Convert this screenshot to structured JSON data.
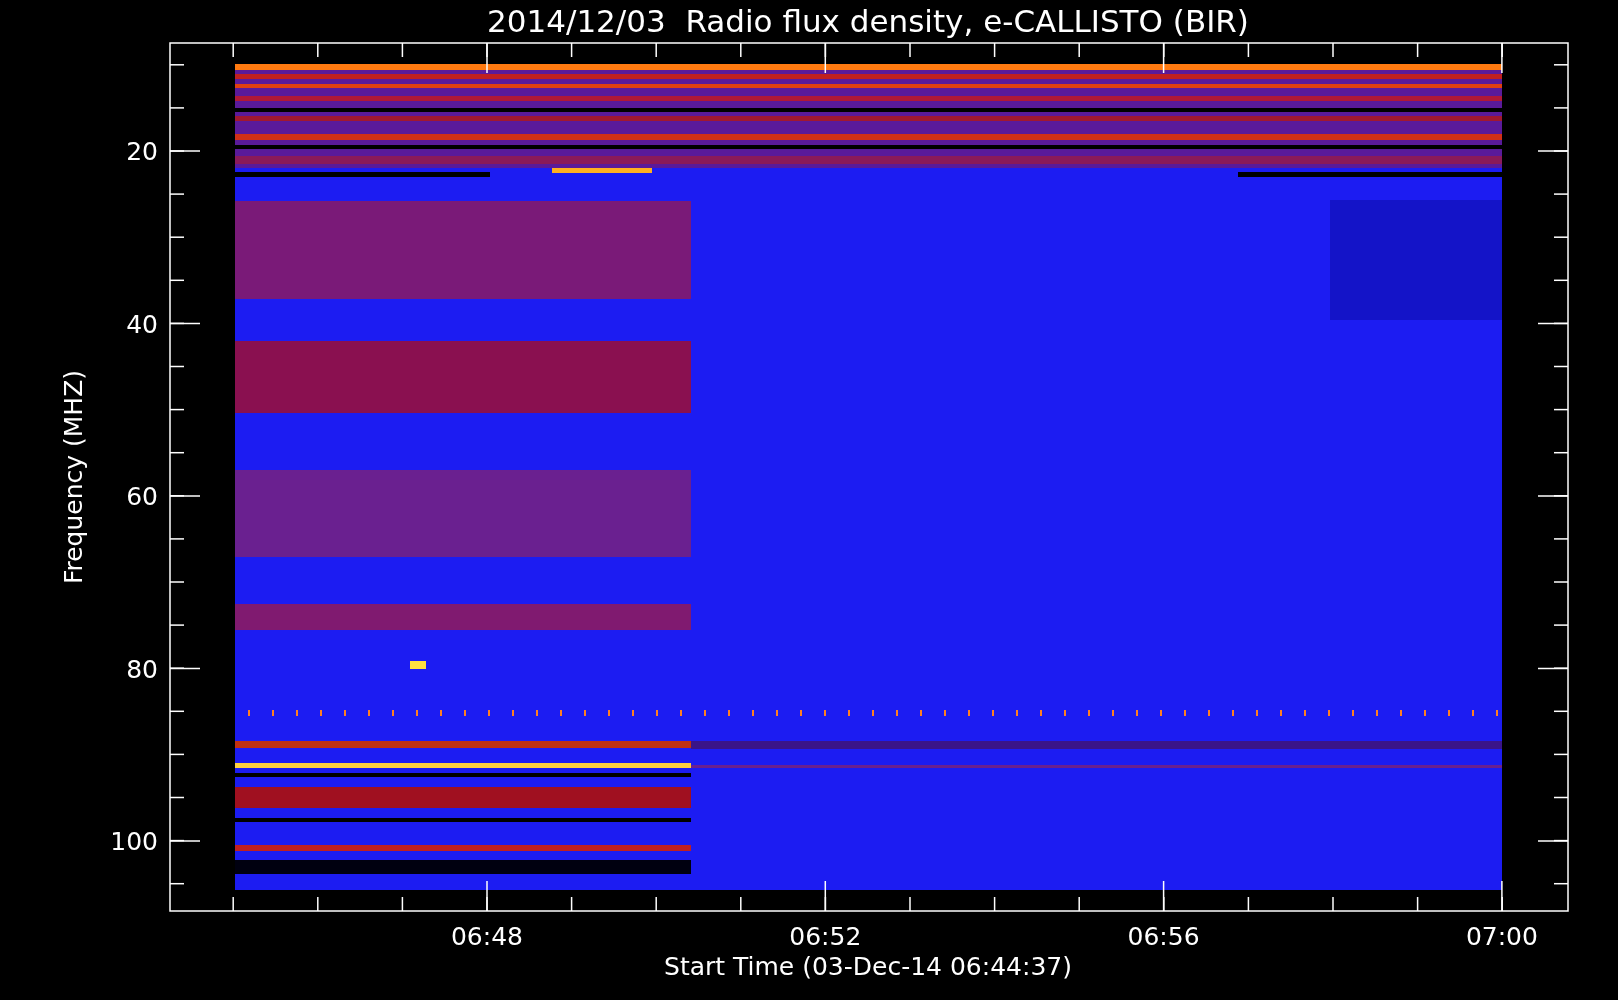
{
  "title": "2014/12/03  Radio flux density, e-CALLISTO (BIR)",
  "y_axis": {
    "label": "Frequency (MHZ)",
    "ticks": [
      "20",
      "40",
      "60",
      "80",
      "100"
    ]
  },
  "x_axis": {
    "label": "Start Time (03-Dec-14 06:44:37)",
    "ticks": [
      "06:48",
      "06:52",
      "06:56",
      "07:00"
    ]
  }
}
